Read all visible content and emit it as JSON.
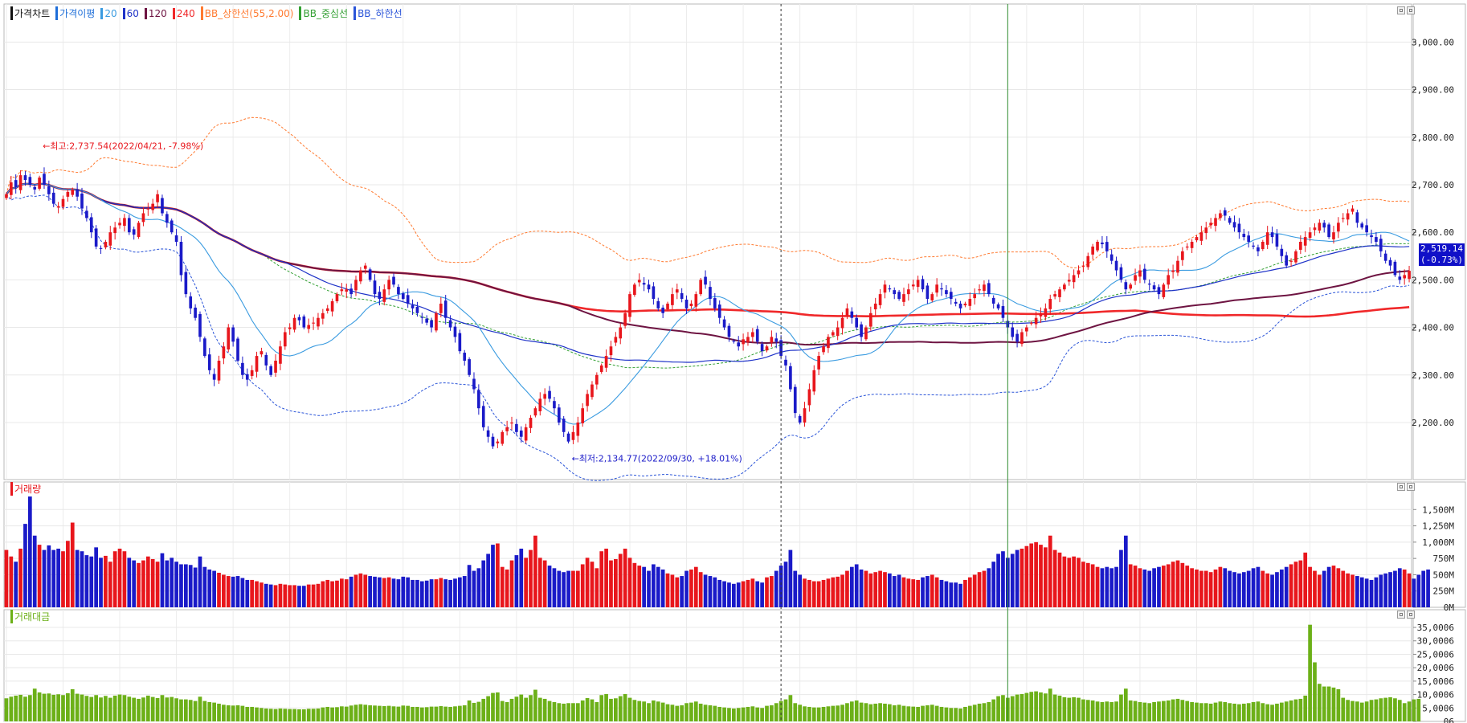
{
  "colors": {
    "up": "#e8161c",
    "down": "#1a1ac8",
    "ma20": "#3a9be0",
    "ma60": "#1e32c8",
    "ma120": "#6e1442",
    "ma240": "#f0282a",
    "bb_upper": "#ff7a30",
    "bb_mid": "#33a033",
    "bb_lower": "#2a54d8",
    "amount": "#6cb018",
    "marker": "#2e8b2e"
  },
  "legends": {
    "price": [
      {
        "text": "가격차트",
        "color": "#111111"
      },
      {
        "text": "가격이평",
        "color": "#1e6ed8"
      },
      {
        "text": "20",
        "color": "#3a9be0"
      },
      {
        "text": "60",
        "color": "#1e32c8"
      },
      {
        "text": "120",
        "color": "#6e1442"
      },
      {
        "text": "240",
        "color": "#f0282a"
      },
      {
        "text": "BB_상한선(55,2.00)",
        "color": "#ff7a30"
      },
      {
        "text": "BB_중심선",
        "color": "#33a033"
      },
      {
        "text": "BB_하한선",
        "color": "#2a54d8"
      }
    ],
    "volume": [
      {
        "text": "거래량",
        "color": "#e8161c"
      }
    ],
    "amount": [
      {
        "text": "거래대금",
        "color": "#6cb018"
      }
    ]
  },
  "last_price": {
    "value": "2,519.14",
    "change": "(-0.73%)"
  },
  "chart_data": [
    {
      "type": "candlestick",
      "title": "가격차트",
      "ylim": [
        2080,
        3080
      ],
      "yticks": [
        "3,000.00",
        "2,900.00",
        "2,800.00",
        "2,700.00",
        "2,600.00",
        "2,500.00",
        "2,400.00",
        "2,300.00",
        "2,200.00"
      ],
      "ytick_values": [
        3000,
        2900,
        2800,
        2700,
        2600,
        2500,
        2400,
        2300,
        2200
      ],
      "grid": true,
      "annotations": [
        {
          "text": "←최고:2,737.54(2022/04/21, -7.98%)",
          "bar": 7,
          "price": 2737.54,
          "color": "#e8161c"
        },
        {
          "text": "←최저:2,134.77(2022/09/30, +18.01%)",
          "bar": 119,
          "price": 2134.77,
          "color": "#1a1ac8"
        }
      ],
      "series": [
        {
          "name": "20",
          "color": "#3a9be0"
        },
        {
          "name": "60",
          "color": "#1e32c8"
        },
        {
          "name": "120",
          "color": "#6e1442"
        },
        {
          "name": "240",
          "color": "#f0282a"
        },
        {
          "name": "BB_상한선(55,2.00)",
          "color": "#ff7a30"
        },
        {
          "name": "BB_중심선",
          "color": "#33a033"
        },
        {
          "name": "BB_하한선",
          "color": "#2a54d8"
        }
      ],
      "closes": [
        2680,
        2705,
        2695,
        2720,
        2710,
        2700,
        2690,
        2715,
        2700,
        2680,
        2660,
        2655,
        2670,
        2685,
        2690,
        2675,
        2650,
        2630,
        2600,
        2570,
        2565,
        2580,
        2600,
        2610,
        2620,
        2630,
        2600,
        2595,
        2620,
        2640,
        2650,
        2660,
        2680,
        2640,
        2620,
        2600,
        2580,
        2510,
        2470,
        2440,
        2420,
        2380,
        2340,
        2310,
        2290,
        2330,
        2360,
        2400,
        2370,
        2330,
        2300,
        2290,
        2310,
        2340,
        2350,
        2320,
        2300,
        2330,
        2360,
        2390,
        2400,
        2420,
        2415,
        2400,
        2405,
        2410,
        2420,
        2430,
        2440,
        2455,
        2470,
        2480,
        2480,
        2470,
        2500,
        2520,
        2530,
        2500,
        2470,
        2460,
        2480,
        2500,
        2490,
        2470,
        2460,
        2450,
        2440,
        2430,
        2420,
        2410,
        2400,
        2430,
        2450,
        2420,
        2400,
        2380,
        2350,
        2330,
        2300,
        2270,
        2230,
        2190,
        2170,
        2150,
        2160,
        2180,
        2190,
        2200,
        2180,
        2170,
        2190,
        2210,
        2230,
        2250,
        2260,
        2250,
        2230,
        2200,
        2180,
        2160,
        2180,
        2200,
        2230,
        2260,
        2280,
        2300,
        2320,
        2340,
        2360,
        2380,
        2400,
        2430,
        2470,
        2490,
        2500,
        2490,
        2480,
        2460,
        2440,
        2430,
        2450,
        2470,
        2480,
        2460,
        2440,
        2450,
        2470,
        2500,
        2490,
        2460,
        2440,
        2420,
        2400,
        2380,
        2370,
        2360,
        2375,
        2380,
        2390,
        2370,
        2350,
        2360,
        2380,
        2370,
        2340,
        2320,
        2270,
        2220,
        2200,
        2230,
        2270,
        2310,
        2340,
        2360,
        2380,
        2390,
        2400,
        2420,
        2440,
        2420,
        2400,
        2380,
        2400,
        2430,
        2450,
        2470,
        2490,
        2480,
        2470,
        2460,
        2470,
        2480,
        2490,
        2500,
        2480,
        2460,
        2470,
        2490,
        2480,
        2470,
        2460,
        2450,
        2440,
        2450,
        2460,
        2470,
        2480,
        2490,
        2470,
        2450,
        2440,
        2420,
        2400,
        2380,
        2370,
        2390,
        2400,
        2410,
        2420,
        2430,
        2440,
        2460,
        2470,
        2480,
        2490,
        2500,
        2510,
        2520,
        2530,
        2550,
        2570,
        2580,
        2575,
        2560,
        2540,
        2520,
        2500,
        2480,
        2490,
        2510,
        2520,
        2500,
        2490,
        2480,
        2470,
        2490,
        2510,
        2520,
        2540,
        2560,
        2570,
        2580,
        2590,
        2600,
        2610,
        2620,
        2630,
        2640,
        2635,
        2620,
        2610,
        2600,
        2590,
        2580,
        2570,
        2560,
        2580,
        2600,
        2590,
        2570,
        2550,
        2530,
        2540,
        2560,
        2580,
        2590,
        2600,
        2610,
        2620,
        2610,
        2590,
        2600,
        2620,
        2630,
        2640,
        2650,
        2620,
        2610,
        2600,
        2590,
        2580,
        2560,
        2540,
        2530,
        2510,
        2500,
        2510,
        2519
      ]
    },
    {
      "type": "bar",
      "title": "거래량",
      "ylim": [
        0,
        1750
      ],
      "yticks": [
        "1,500M",
        "1,250M",
        "1,000M",
        "750M",
        "500M",
        "250M",
        "0M"
      ],
      "ytick_values": [
        1500,
        1250,
        1000,
        750,
        500,
        250,
        0
      ],
      "values": [
        880,
        780,
        700,
        900,
        1280,
        1700,
        1100,
        960,
        880,
        950,
        880,
        900,
        860,
        1020,
        1300,
        880,
        860,
        800,
        780,
        920,
        760,
        790,
        700,
        860,
        900,
        860,
        760,
        720,
        680,
        720,
        780,
        740,
        700,
        830,
        720,
        760,
        700,
        660,
        660,
        650,
        610,
        780,
        620,
        580,
        560,
        530,
        500,
        480,
        470,
        480,
        450,
        420,
        420,
        400,
        380,
        360,
        350,
        340,
        360,
        350,
        340,
        340,
        330,
        330,
        350,
        350,
        360,
        400,
        420,
        400,
        410,
        440,
        430,
        470,
        500,
        520,
        500,
        480,
        470,
        460,
        450,
        460,
        440,
        430,
        470,
        460,
        420,
        420,
        400,
        410,
        430,
        430,
        450,
        430,
        420,
        440,
        460,
        480,
        650,
        560,
        600,
        720,
        820,
        960,
        980,
        620,
        580,
        720,
        800,
        900,
        760,
        880,
        1100,
        760,
        720,
        640,
        600,
        560,
        540,
        560,
        560,
        560,
        660,
        760,
        700,
        600,
        860,
        900,
        720,
        740,
        820,
        900,
        760,
        680,
        640,
        620,
        560,
        660,
        620,
        580,
        520,
        500,
        460,
        480,
        560,
        580,
        620,
        540,
        500,
        480,
        460,
        420,
        400,
        380,
        360,
        380,
        400,
        420,
        440,
        400,
        380,
        460,
        480,
        560,
        640,
        700,
        880,
        560,
        500,
        440,
        420,
        400,
        400,
        420,
        440,
        460,
        470,
        500,
        560,
        620,
        660,
        580,
        560,
        520,
        540,
        560,
        540,
        520,
        480,
        500,
        460,
        440,
        430,
        420,
        460,
        480,
        500,
        460,
        420,
        400,
        380,
        380,
        360,
        420,
        460,
        500,
        540,
        560,
        600,
        700,
        820,
        860,
        760,
        820,
        880,
        900,
        940,
        980,
        1000,
        960,
        920,
        1100,
        880,
        840,
        780,
        760,
        780,
        760,
        700,
        680,
        660,
        620,
        600,
        620,
        600,
        620,
        880,
        1100,
        660,
        640,
        600,
        580,
        560,
        600,
        620,
        640,
        660,
        700,
        720,
        680,
        640,
        600,
        580,
        560,
        560,
        540,
        580,
        620,
        600,
        560,
        540,
        520,
        540,
        560,
        600,
        620,
        560,
        520,
        500,
        540,
        580,
        620,
        660,
        700,
        720,
        840,
        620,
        560,
        500,
        560,
        620,
        640,
        600,
        560,
        520,
        500,
        480,
        460,
        440,
        420,
        460,
        500,
        520,
        540,
        560,
        600,
        580,
        520,
        440,
        500,
        560,
        580
      ]
    },
    {
      "type": "bar",
      "title": "거래대금",
      "ylim": [
        0,
        38000
      ],
      "yticks": [
        "35,0006",
        "30,0006",
        "25,0006",
        "20,0006",
        "15,0006",
        "10,0006",
        "5,0006",
        "06"
      ],
      "ytick_values": [
        35000,
        30000,
        25000,
        20000,
        15000,
        10000,
        5000,
        0
      ],
      "values": [
        8600,
        9200,
        9600,
        9900,
        9200,
        9800,
        12200,
        10800,
        10300,
        10400,
        9900,
        10100,
        9800,
        10500,
        12000,
        10300,
        10000,
        9500,
        9100,
        9800,
        8900,
        9500,
        8800,
        9600,
        10000,
        9800,
        9200,
        8800,
        8400,
        8900,
        9600,
        9100,
        8700,
        9800,
        8900,
        9100,
        8600,
        8200,
        8200,
        8000,
        7600,
        9200,
        7600,
        7200,
        7000,
        6600,
        6200,
        6000,
        5900,
        6000,
        5800,
        5400,
        5400,
        5200,
        5000,
        4800,
        4700,
        4600,
        4800,
        4700,
        4600,
        4600,
        4500,
        4500,
        4700,
        4700,
        4800,
        5200,
        5400,
        5200,
        5300,
        5600,
        5500,
        5900,
        6200,
        6400,
        6200,
        6000,
        5900,
        5800,
        5700,
        5800,
        5600,
        5500,
        5900,
        5800,
        5400,
        5400,
        5200,
        5300,
        5500,
        5500,
        5700,
        5500,
        5400,
        5600,
        5800,
        6000,
        7800,
        6900,
        7300,
        8400,
        9400,
        10600,
        10800,
        7600,
        7200,
        8400,
        9200,
        10000,
        8800,
        9800,
        11800,
        8800,
        8400,
        7600,
        7200,
        6800,
        6600,
        6800,
        6800,
        6800,
        7800,
        8700,
        8200,
        7200,
        9800,
        10200,
        8400,
        8600,
        9400,
        10200,
        8800,
        8000,
        7600,
        7400,
        6800,
        7800,
        7400,
        7000,
        6400,
        6200,
        5800,
        6000,
        6800,
        7000,
        7400,
        6600,
        6200,
        6000,
        5800,
        5400,
        5200,
        5000,
        4800,
        5000,
        5200,
        5400,
        5600,
        5200,
        5000,
        5800,
        6000,
        6800,
        7600,
        8200,
        9800,
        6800,
        6200,
        5600,
        5400,
        5200,
        5200,
        5400,
        5600,
        5800,
        5900,
        6200,
        6800,
        7400,
        7800,
        7000,
        6800,
        6400,
        6600,
        6800,
        6600,
        6400,
        6000,
        6200,
        5800,
        5600,
        5500,
        5400,
        5800,
        6000,
        6200,
        5800,
        5400,
        5200,
        5000,
        5000,
        4800,
        5400,
        5800,
        6200,
        6600,
        6800,
        7200,
        8200,
        9400,
        9800,
        8800,
        9400,
        10000,
        10200,
        10600,
        11000,
        11200,
        10800,
        10400,
        12200,
        10000,
        9600,
        9000,
        8800,
        9000,
        8800,
        8200,
        8000,
        7800,
        7400,
        7200,
        7400,
        7200,
        7400,
        10000,
        12200,
        7800,
        7600,
        7200,
        7000,
        6800,
        7200,
        7400,
        7600,
        7800,
        8200,
        8400,
        8000,
        7600,
        7200,
        7000,
        6800,
        6800,
        6600,
        7000,
        7400,
        7200,
        6800,
        6600,
        6400,
        6600,
        6800,
        7200,
        7400,
        6800,
        6400,
        6200,
        6600,
        7000,
        7400,
        7800,
        8200,
        8400,
        9600,
        36000,
        22000,
        14000,
        13000,
        13000,
        12600,
        12000,
        8800,
        8000,
        7600,
        7400,
        7000,
        7400,
        8000,
        8200,
        8600,
        8800,
        9000,
        8600,
        8000,
        6800,
        7400,
        8200,
        8400
      ]
    }
  ]
}
